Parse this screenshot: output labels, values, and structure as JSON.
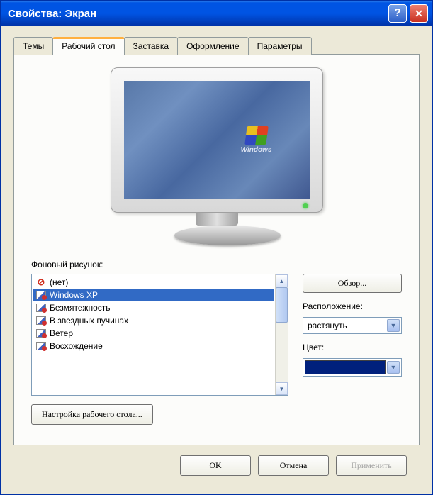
{
  "window": {
    "title": "Свойства: Экран"
  },
  "tabs": {
    "themes": "Темы",
    "desktop": "Рабочий стол",
    "screensaver": "Заставка",
    "appearance": "Оформление",
    "settings": "Параметры"
  },
  "preview": {
    "logo_text": "Windows"
  },
  "background": {
    "label": "Фоновый рисунок:",
    "items": [
      {
        "name": "(нет)",
        "icon": "none",
        "selected": false
      },
      {
        "name": "Windows XP",
        "icon": "img",
        "selected": true
      },
      {
        "name": "Безмятежность",
        "icon": "img",
        "selected": false
      },
      {
        "name": "В звездных пучинах",
        "icon": "img",
        "selected": false
      },
      {
        "name": "Ветер",
        "icon": "img",
        "selected": false
      },
      {
        "name": "Восхождение",
        "icon": "img",
        "selected": false
      }
    ],
    "browse": "Обзор...",
    "position_label": "Расположение:",
    "position_value": "растянуть",
    "color_label": "Цвет:",
    "color_value": "#00207c"
  },
  "customize": "Настройка рабочего стола...",
  "buttons": {
    "ok": "OK",
    "cancel": "Отмена",
    "apply": "Применить"
  }
}
